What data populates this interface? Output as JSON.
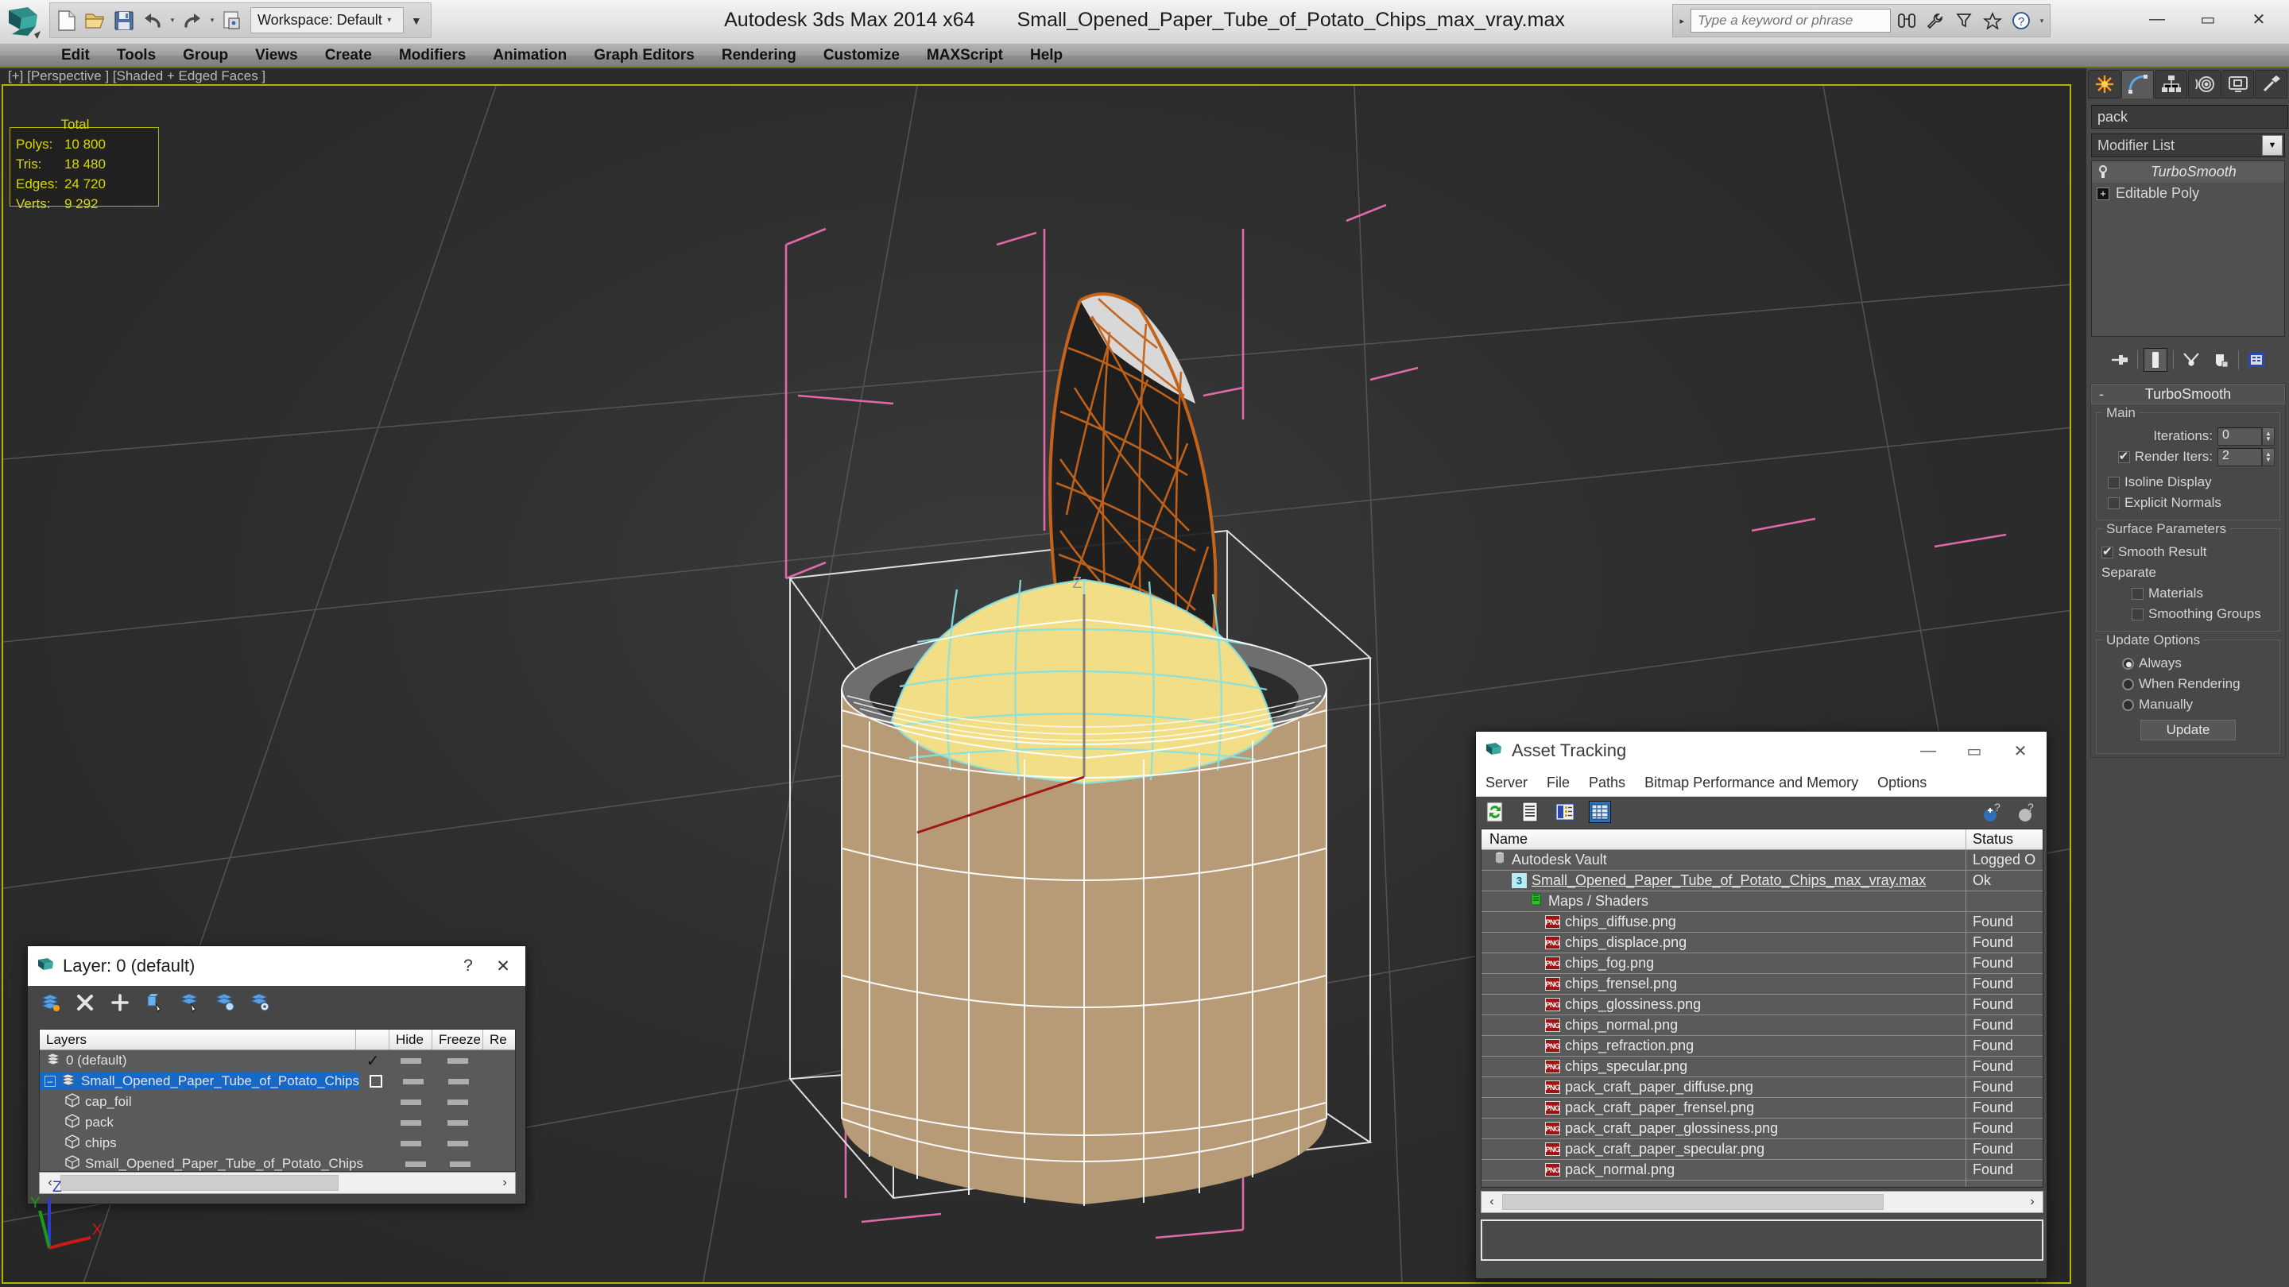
{
  "titlebar": {
    "app_title": "Autodesk 3ds Max  2014 x64",
    "file_name": "Small_Opened_Paper_Tube_of_Potato_Chips_max_vray.max",
    "workspace_label": "Workspace: Default",
    "quick_access": [
      "new-icon",
      "open-icon",
      "save-icon",
      "undo-icon",
      "redo-icon",
      "project-icon"
    ],
    "search_placeholder": "Type a keyword or phrase",
    "search_value": "",
    "search_icons": [
      "binoculars-icon",
      "wrench-icon",
      "funnel-icon",
      "star-icon",
      "help-icon"
    ],
    "window_buttons": [
      "minimize",
      "maximize",
      "close"
    ]
  },
  "menubar": {
    "items": [
      "Edit",
      "Tools",
      "Group",
      "Views",
      "Create",
      "Modifiers",
      "Animation",
      "Graph Editors",
      "Rendering",
      "Customize",
      "MAXScript",
      "Help"
    ]
  },
  "viewport": {
    "label": "[+] [Perspective ] [Shaded + Edged Faces ]",
    "stats_header": "Total",
    "stats": [
      {
        "name": "Polys:",
        "value": "10 800"
      },
      {
        "name": "Tris:",
        "value": "18 480"
      },
      {
        "name": "Edges:",
        "value": "24 720"
      },
      {
        "name": "Verts:",
        "value": "9 292"
      }
    ],
    "axis": {
      "x": "X",
      "y": "Y",
      "z": "Z"
    },
    "gizmo_axis_label": "Z"
  },
  "command_panel": {
    "tabs": [
      "create-tab-icon",
      "modify-tab-icon",
      "hierarchy-tab-icon",
      "motion-tab-icon",
      "display-tab-icon",
      "utilities-tab-icon"
    ],
    "selected_tab_index": 1,
    "object_name": "pack",
    "object_color": "#3fbd7f",
    "modifier_list_label": "Modifier List",
    "stack": [
      {
        "label": "TurboSmooth",
        "selected": true,
        "italic": true
      },
      {
        "label": "Editable Poly",
        "selected": false,
        "italic": false
      }
    ],
    "stack_tools": [
      "pin-stack-icon",
      "show-end-result-icon",
      "make-unique-icon",
      "remove-modifier-icon",
      "configure-sets-icon"
    ],
    "rollout": {
      "title": "TurboSmooth",
      "collapse_glyph": "-",
      "main_group": "Main",
      "iterations_label": "Iterations:",
      "iterations_value": "0",
      "render_iters_label": "Render Iters:",
      "render_iters_value": "2",
      "render_iters_checked": true,
      "isoline_label": "Isoline Display",
      "isoline_checked": false,
      "explicit_normals_label": "Explicit Normals",
      "explicit_normals_checked": false,
      "surface_group": "Surface Parameters",
      "smooth_result_label": "Smooth Result",
      "smooth_result_checked": true,
      "separate_label": "Separate",
      "materials_label": "Materials",
      "materials_checked": false,
      "smoothing_groups_label": "Smoothing Groups",
      "smoothing_groups_checked": false,
      "update_group": "Update Options",
      "update_always": "Always",
      "update_when_rendering": "When Rendering",
      "update_manually": "Manually",
      "update_selected": "Always",
      "update_button": "Update"
    }
  },
  "layer_dialog": {
    "title": "Layer: 0 (default)",
    "help_glyph": "?",
    "close_glyph": "✕",
    "toolbar": [
      "create-new-layer-icon",
      "delete-layer-icon",
      "add-selection-icon",
      "select-objects-icon",
      "select-highlighted-icon",
      "highlight-selected-icon",
      "layer-properties-icon"
    ],
    "columns": [
      "Layers",
      "",
      "Hide",
      "Freeze",
      "Re"
    ],
    "rows": [
      {
        "name": "0 (default)",
        "indent": 0,
        "selected": false,
        "mark": "check",
        "expander": false
      },
      {
        "name": "Small_Opened_Paper_Tube_of_Potato_Chips",
        "indent": 0,
        "selected": true,
        "mark": "box",
        "expander": true
      },
      {
        "name": "cap_foil",
        "indent": 1,
        "selected": false,
        "mark": "",
        "expander": false
      },
      {
        "name": "pack",
        "indent": 1,
        "selected": false,
        "mark": "",
        "expander": false
      },
      {
        "name": "chips",
        "indent": 1,
        "selected": false,
        "mark": "",
        "expander": false
      },
      {
        "name": "Small_Opened_Paper_Tube_of_Potato_Chips",
        "indent": 1,
        "selected": false,
        "mark": "",
        "expander": false
      }
    ],
    "scroll_left": "‹",
    "scroll_right": "›"
  },
  "asset_tracking": {
    "title": "Asset Tracking",
    "window_buttons": [
      "minimize",
      "maximize",
      "close"
    ],
    "menu": [
      "Server",
      "File",
      "Paths",
      "Bitmap Performance and Memory",
      "Options"
    ],
    "toolbar": [
      "refresh-icon",
      "list-view-icon",
      "detail-view-icon",
      "grid-view-icon"
    ],
    "toolbar_selected_index": 3,
    "help_icons": [
      "add-help-icon",
      "help-icon"
    ],
    "columns": [
      "Name",
      "Status"
    ],
    "rows": [
      {
        "name": "Autodesk Vault",
        "status": "Logged O",
        "indent": 0,
        "icon": "vault-icon"
      },
      {
        "name": "Small_Opened_Paper_Tube_of_Potato_Chips_max_vray.max",
        "status": "Ok",
        "indent": 1,
        "icon": "max-file-icon"
      },
      {
        "name": "Maps / Shaders",
        "status": "",
        "indent": 2,
        "icon": "maps-icon"
      },
      {
        "name": "chips_diffuse.png",
        "status": "Found",
        "indent": 3,
        "icon": "png-icon"
      },
      {
        "name": "chips_displace.png",
        "status": "Found",
        "indent": 3,
        "icon": "png-icon"
      },
      {
        "name": "chips_fog.png",
        "status": "Found",
        "indent": 3,
        "icon": "png-icon"
      },
      {
        "name": "chips_frensel.png",
        "status": "Found",
        "indent": 3,
        "icon": "png-icon"
      },
      {
        "name": "chips_glossiness.png",
        "status": "Found",
        "indent": 3,
        "icon": "png-icon"
      },
      {
        "name": "chips_normal.png",
        "status": "Found",
        "indent": 3,
        "icon": "png-icon"
      },
      {
        "name": "chips_refraction.png",
        "status": "Found",
        "indent": 3,
        "icon": "png-icon"
      },
      {
        "name": "chips_specular.png",
        "status": "Found",
        "indent": 3,
        "icon": "png-icon"
      },
      {
        "name": "pack_craft_paper_diffuse.png",
        "status": "Found",
        "indent": 3,
        "icon": "png-icon"
      },
      {
        "name": "pack_craft_paper_frensel.png",
        "status": "Found",
        "indent": 3,
        "icon": "png-icon"
      },
      {
        "name": "pack_craft_paper_glossiness.png",
        "status": "Found",
        "indent": 3,
        "icon": "png-icon"
      },
      {
        "name": "pack_craft_paper_specular.png",
        "status": "Found",
        "indent": 3,
        "icon": "png-icon"
      },
      {
        "name": "pack_normal.png",
        "status": "Found",
        "indent": 3,
        "icon": "png-icon"
      }
    ],
    "scroll_left": "‹",
    "scroll_right": "›"
  },
  "colors": {
    "accent_yellow": "#b3b300",
    "selection_blue": "#1669c6",
    "object_green": "#3fbd7f",
    "chips_yellow": "#f2de86",
    "pack_tan": "#b79b77",
    "foil_orange": "#c4631a",
    "gizmo_pink": "#e06aa8"
  }
}
